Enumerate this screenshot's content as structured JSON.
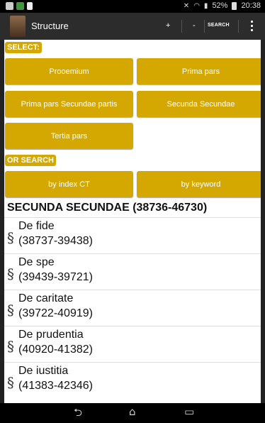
{
  "statusbar": {
    "battery": "52%",
    "time": "20:38",
    "left_icons": [
      "mail-icon",
      "app-icon",
      "file-icon"
    ],
    "right_icons": [
      "mute-icon",
      "wifi-icon",
      "signal-icon",
      "battery-icon"
    ]
  },
  "actionbar": {
    "title": "Structure",
    "plus_label": "+",
    "minus_label": "-",
    "search_label": "SEARCH"
  },
  "select_label": "SELECT:",
  "parts": {
    "prooemium": "Prooemium",
    "prima_pars": "Prima pars",
    "prima_secundae": "Prima pars Secundae partis",
    "secunda_secundae": "Secunda Secundae",
    "tertia_pars": "Tertia pars"
  },
  "or_search_label": "OR SEARCH",
  "search": {
    "by_index": "by index CT",
    "by_keyword": "by keyword"
  },
  "section_title": "SECUNDA SECUNDAE (38736-46730)",
  "items": [
    {
      "name": "De fide",
      "range": "(38737-39438)"
    },
    {
      "name": "De spe",
      "range": "(39439-39721)"
    },
    {
      "name": "De caritate",
      "range": "(39722-40919)"
    },
    {
      "name": "De prudentia",
      "range": "(40920-41382)"
    },
    {
      "name": "De iustitia",
      "range": "(41383-42346)"
    }
  ],
  "section_mark": "§",
  "navbar": {
    "back_glyph": "⮌",
    "home_glyph": "⌂",
    "recent_glyph": "▭"
  },
  "colors": {
    "accent": "#d4a800",
    "actionbar": "#2c2c2c",
    "background": "#ffffff"
  }
}
